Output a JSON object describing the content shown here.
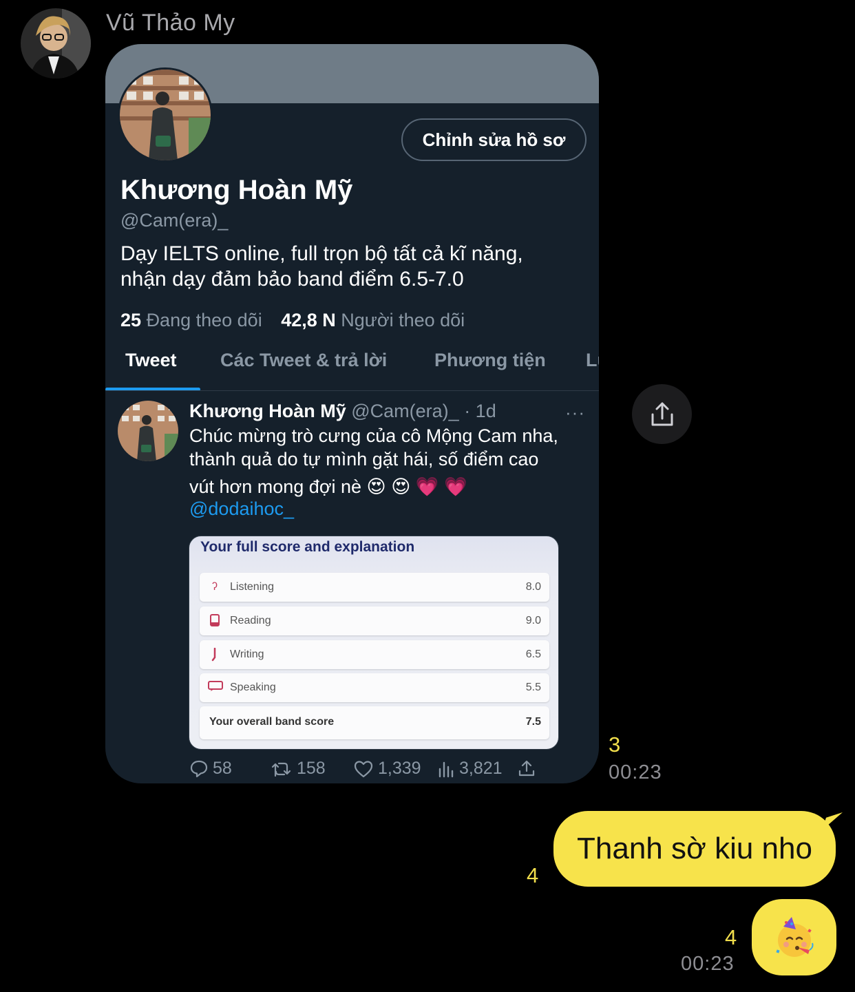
{
  "chat": {
    "sender_name": "Vũ Thảo My"
  },
  "profile": {
    "edit_button": "Chỉnh sửa hồ sơ",
    "display_name": "Khương Hoàn Mỹ",
    "handle": "@Cam(era)_",
    "bio_line1": "Dạy IELTS online, full trọn bộ tất cả kĩ năng,",
    "bio_line2": "nhận dạy đảm bảo band điểm 6.5-7.0",
    "following_count": "25",
    "following_label": "Đang theo dõi",
    "followers_count": "42,8 N",
    "followers_label": "Người theo dõi",
    "tabs": [
      {
        "label": "Tweet"
      },
      {
        "label": "Các Tweet & trả lời"
      },
      {
        "label": "Phương tiện"
      },
      {
        "label": "Lư"
      }
    ]
  },
  "tweet": {
    "author": "Khương Hoàn Mỹ",
    "meta": "@Cam(era)_ · 1d",
    "more": "···",
    "line1": "Chúc mừng trò cưng của cô Mộng Cam nha,",
    "line2": "thành quả do tự mình gặt hái, số điểm cao",
    "line3": "vút hơn mong đợi nè 😍 😍 💗 💗",
    "mention": "@dodaihoc_",
    "replies": "58",
    "retweets": "158",
    "likes": "1,339",
    "views": "3,821"
  },
  "score_card": {
    "title": "Your full score and explanation",
    "rows": [
      {
        "label": "Listening",
        "value": "8.0"
      },
      {
        "label": "Reading",
        "value": "9.0"
      },
      {
        "label": "Writing",
        "value": "6.5"
      },
      {
        "label": "Speaking",
        "value": "5.5"
      }
    ],
    "overall_label": "Your overall band score",
    "overall_value": "7.5"
  },
  "messages": {
    "msg1_read": "3",
    "msg1_time": "00:23",
    "msg2_text": "Thanh sờ kiu nho",
    "msg2_read": "4",
    "msg3_emoji": "🥳",
    "msg3_read": "4",
    "msg3_time": "00:23"
  },
  "colors": {
    "bubble": "#f7e34b",
    "read_count": "#f2df4c",
    "twitter_bg": "#15202b",
    "twitter_blue": "#1d9bf0"
  }
}
